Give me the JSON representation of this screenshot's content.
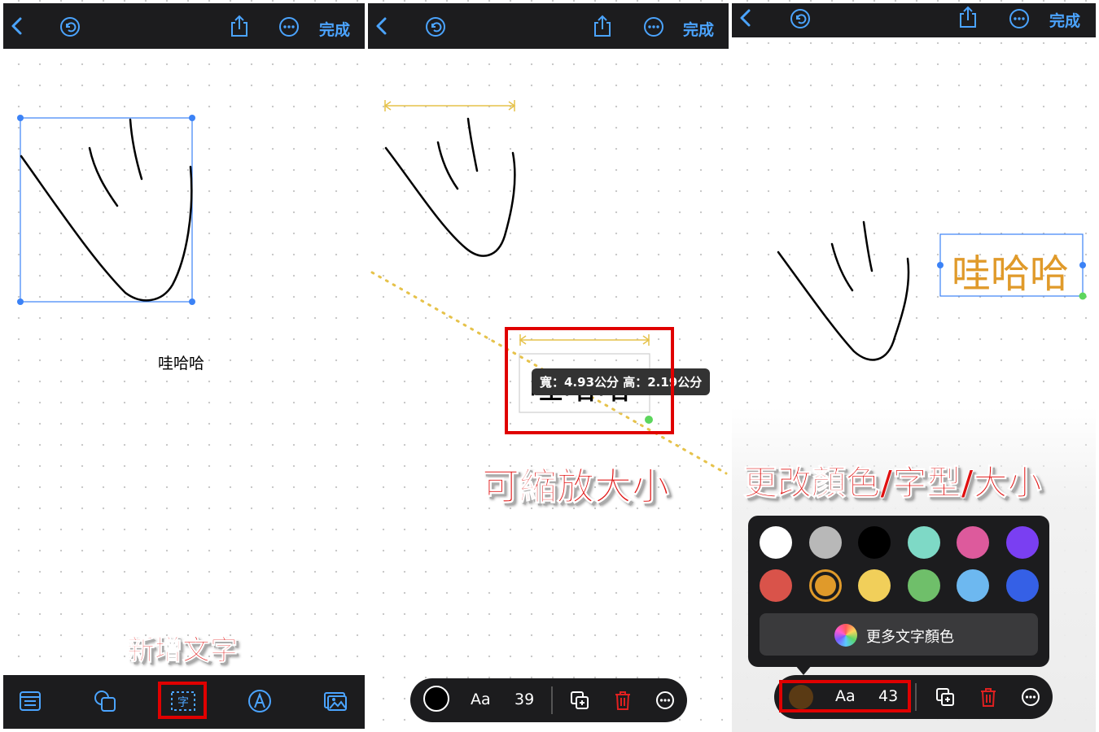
{
  "toolbar": {
    "back_icon": "chevron-left-icon",
    "undo_icon": "undo-icon",
    "share_icon": "share-icon",
    "more_icon": "ellipsis-circle-icon",
    "done_label": "完成"
  },
  "colors": {
    "bar_bg": "#1c1c1e",
    "accent": "#4ba4ff",
    "selection": "#3b82f6",
    "annotation_red": "#e00000",
    "text_orange": "#e09a2a",
    "guide_yellow": "#e6c24a"
  },
  "panel1": {
    "text_object": "哇哈哈",
    "caption": "新增文字",
    "bottom_tools": [
      {
        "name": "notes-icon"
      },
      {
        "name": "shapes-icon"
      },
      {
        "name": "text-box-icon"
      },
      {
        "name": "pen-icon"
      },
      {
        "name": "media-icon"
      }
    ]
  },
  "panel2": {
    "text_object": "哇哈哈",
    "size_tooltip": "寬：4.93公分 高：2.19公分",
    "caption": "可縮放大小",
    "format_bar": {
      "color": "#000000",
      "font_label": "Aa",
      "size_value": "39"
    }
  },
  "panel3": {
    "text_object": "哇哈哈",
    "caption": "更改顏色/字型/大小",
    "palette": [
      "#ffffff",
      "#b8b8b8",
      "#000000",
      "#7ed9c6",
      "#dd5a9c",
      "#7a3ff2",
      "#d9534a",
      "#e09a2a",
      "#f1cf5a",
      "#6fbf6a",
      "#6db8f0",
      "#3560e6"
    ],
    "selected_color_index": 7,
    "more_colors_label": "更多文字顏色",
    "format_bar": {
      "color": "#5a3a14",
      "font_label": "Aa",
      "size_value": "43"
    }
  }
}
